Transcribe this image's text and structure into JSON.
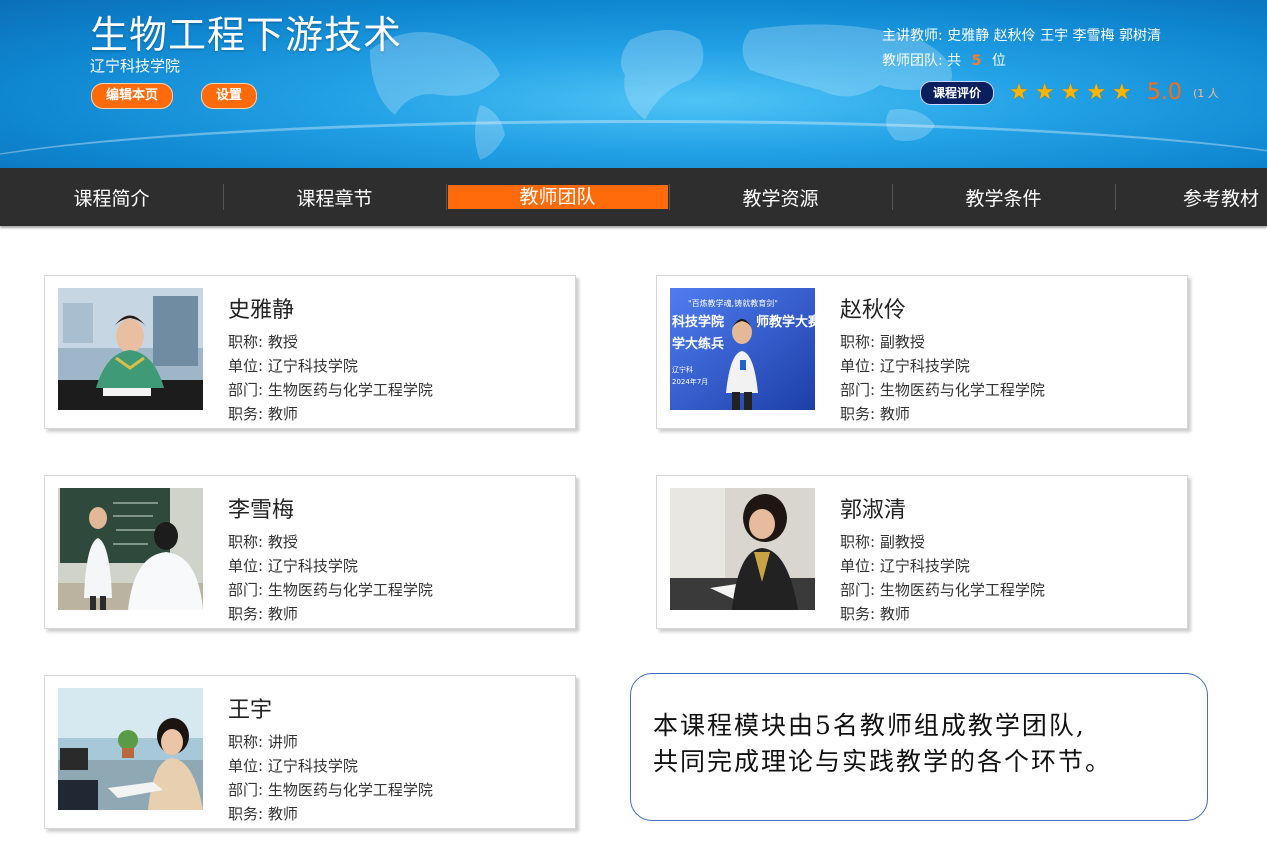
{
  "header": {
    "course_title": "生物工程下游技术",
    "school": "辽宁科技学院",
    "edit_button": "编辑本页",
    "settings_button": "设置",
    "main_teachers_label": "主讲教师:",
    "main_teachers": "史雅静 赵秋伶 王宇 李雪梅 郭树清",
    "team_label": "教师团队:",
    "team_prefix": "共",
    "team_count": "5",
    "team_suffix": "位",
    "evaluation_button": "课程评价",
    "rating_stars": 5,
    "score": "5.0",
    "raters": "(1 人"
  },
  "nav": {
    "items": [
      "课程简介",
      "课程章节",
      "教师团队",
      "教学资源",
      "教学条件",
      "参考教材"
    ],
    "active": "教师团队"
  },
  "teachers": [
    {
      "name": "史雅静",
      "title": "职称: 教授",
      "unit": "单位: 辽宁科技学院",
      "dept": "部门: 生物医药与化学工程学院",
      "post": "职务: 教师"
    },
    {
      "name": "赵秋伶",
      "title": "职称: 副教授",
      "unit": "单位: 辽宁科技学院",
      "dept": "部门: 生物医药与化学工程学院",
      "post": "职务: 教师"
    },
    {
      "name": "李雪梅",
      "title": "职称: 教授",
      "unit": "单位: 辽宁科技学院",
      "dept": "部门: 生物医药与化学工程学院",
      "post": "职务: 教师"
    },
    {
      "name": "郭淑清",
      "title": "职称: 副教授",
      "unit": "单位: 辽宁科技学院",
      "dept": "部门: 生物医药与化学工程学院",
      "post": "职务: 教师"
    },
    {
      "name": "王宇",
      "title": "职称: 讲师",
      "unit": "单位: 辽宁科技学院",
      "dept": "部门: 生物医药与化学工程学院",
      "post": "职务: 教师"
    }
  ],
  "photo2_banner": {
    "line1": "\"百炼教学魂,铸就教育剑\"",
    "line2": "科技学院",
    "line3": "师教学大赛",
    "line4": "学大练兵",
    "line5": "辽宁科",
    "line6": "2024年7月"
  },
  "note": {
    "line1": "本课程模块由5名教师组成教学团队,",
    "line2": "共同完成理论与实践教学的各个环节。"
  },
  "colors": {
    "accent": "#ff6b0a",
    "nav_bg": "#2e2e2e",
    "banner_blue": "#1a96de",
    "star": "#ffb400"
  }
}
